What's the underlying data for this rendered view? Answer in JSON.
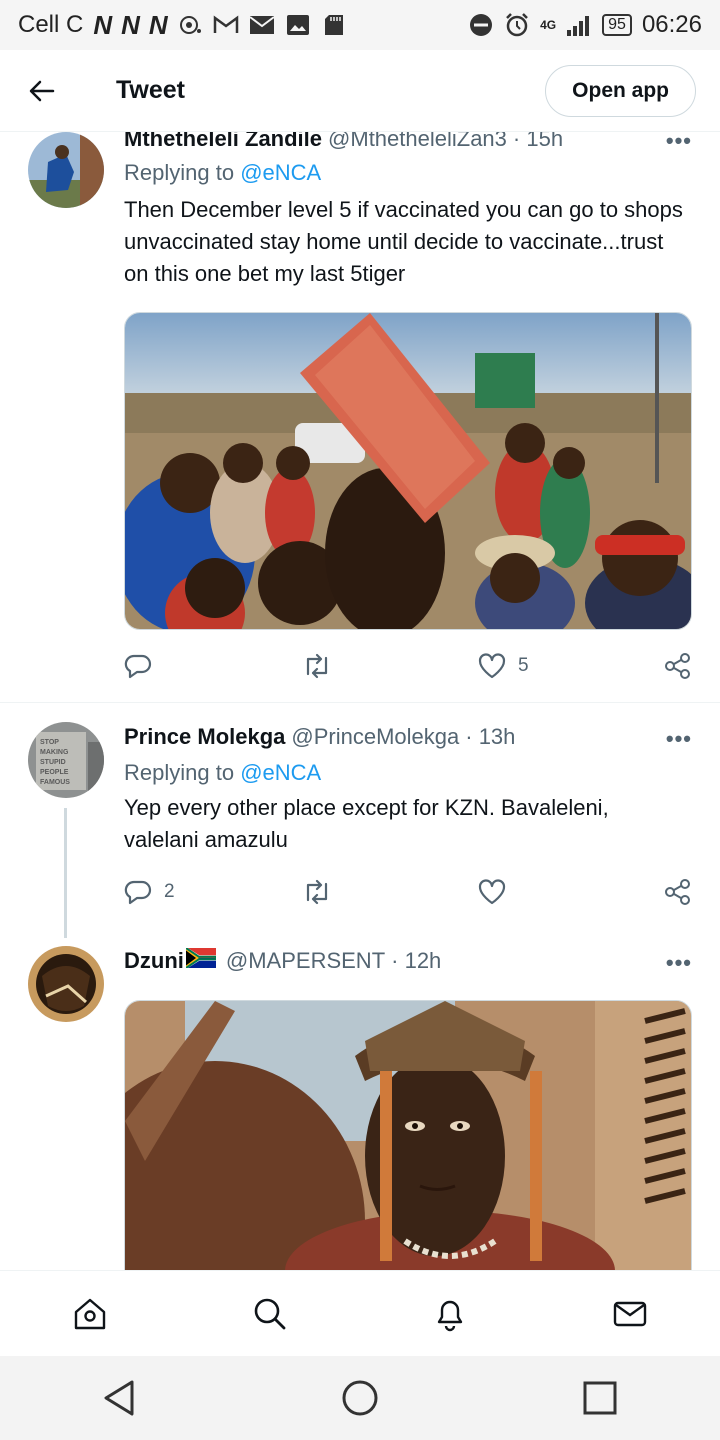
{
  "status_bar": {
    "carrier": "Cell C",
    "notif_letters": [
      "N",
      "N",
      "N"
    ],
    "network": "4G",
    "battery": "95",
    "time": "06:26"
  },
  "header": {
    "title": "Tweet",
    "open_app_label": "Open app"
  },
  "tweets": [
    {
      "name": "Mthetheleli Zandile",
      "handle": "@MthetheleliZan3",
      "time": "· 15h",
      "more": "•••",
      "replying_prefix": "Replying to",
      "replying_to": "@eNCA",
      "text": "Then December level 5 if vaccinated you can go to shops unvaccinated stay home until decide to vaccinate...trust on this one bet my last 5tiger",
      "likes": "5",
      "replies": "",
      "retweets": ""
    },
    {
      "name": "Prince Molekga",
      "handle": "@PrinceMolekga",
      "time": "· 13h",
      "more": "•••",
      "replying_prefix": "Replying to",
      "replying_to": "@eNCA",
      "text": "Yep every other place except for KZN. Bavaleleni, valelani amazulu",
      "replies": "2",
      "likes": "",
      "retweets": "",
      "avatar_text": "STOP MAKING STUPID PEOPLE FAMOUS"
    },
    {
      "name": "Dzuni",
      "handle": "@MAPERSENT",
      "time": "· 12h",
      "more": "•••"
    }
  ],
  "colors": {
    "accent": "#1d9bf0",
    "text": "#0f1419",
    "muted": "#536471",
    "border": "#cfd9de"
  }
}
